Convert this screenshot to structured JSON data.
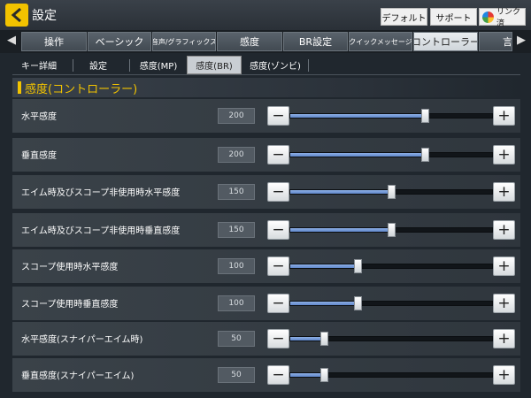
{
  "header": {
    "title": "設定",
    "default_label": "デフォルト",
    "support_label": "サポート",
    "link_label": "リンク済"
  },
  "tabs": [
    {
      "label": "操作",
      "active": false
    },
    {
      "label": "ベーシック",
      "active": false
    },
    {
      "label": "音声/グラフィックス",
      "active": false
    },
    {
      "label": "感度",
      "active": false
    },
    {
      "label": "BR設定",
      "active": false
    },
    {
      "label": "クイックメッセージ",
      "active": false
    },
    {
      "label": "コントローラー",
      "active": true
    },
    {
      "label": "言",
      "active": false
    }
  ],
  "subtabs": [
    {
      "label": "キー詳細",
      "active": false
    },
    {
      "label": "設定",
      "active": false
    },
    {
      "label": "感度(MP)",
      "active": false
    },
    {
      "label": "感度(BR)",
      "active": true
    },
    {
      "label": "感度(ゾンビ)",
      "active": false
    }
  ],
  "section": {
    "title": "感度(コントローラー)"
  },
  "slider_max": 300,
  "rows": [
    {
      "label": "水平感度",
      "value": "200"
    },
    {
      "label": "垂直感度",
      "value": "200"
    },
    {
      "label": "エイム時及びスコープ非使用時水平感度",
      "value": "150"
    },
    {
      "label": "エイム時及びスコープ非使用時垂直感度",
      "value": "150"
    },
    {
      "label": "スコープ使用時水平感度",
      "value": "100"
    },
    {
      "label": "スコープ使用時垂直感度",
      "value": "100"
    },
    {
      "label": "水平感度(スナイパーエイム時)",
      "value": "50"
    },
    {
      "label": "垂直感度(スナイパーエイム)",
      "value": "50"
    }
  ],
  "controls": {
    "minus": "−",
    "plus": "+"
  },
  "colors": {
    "accent": "#f2c300",
    "slider_fill": "#7a9fdc"
  }
}
